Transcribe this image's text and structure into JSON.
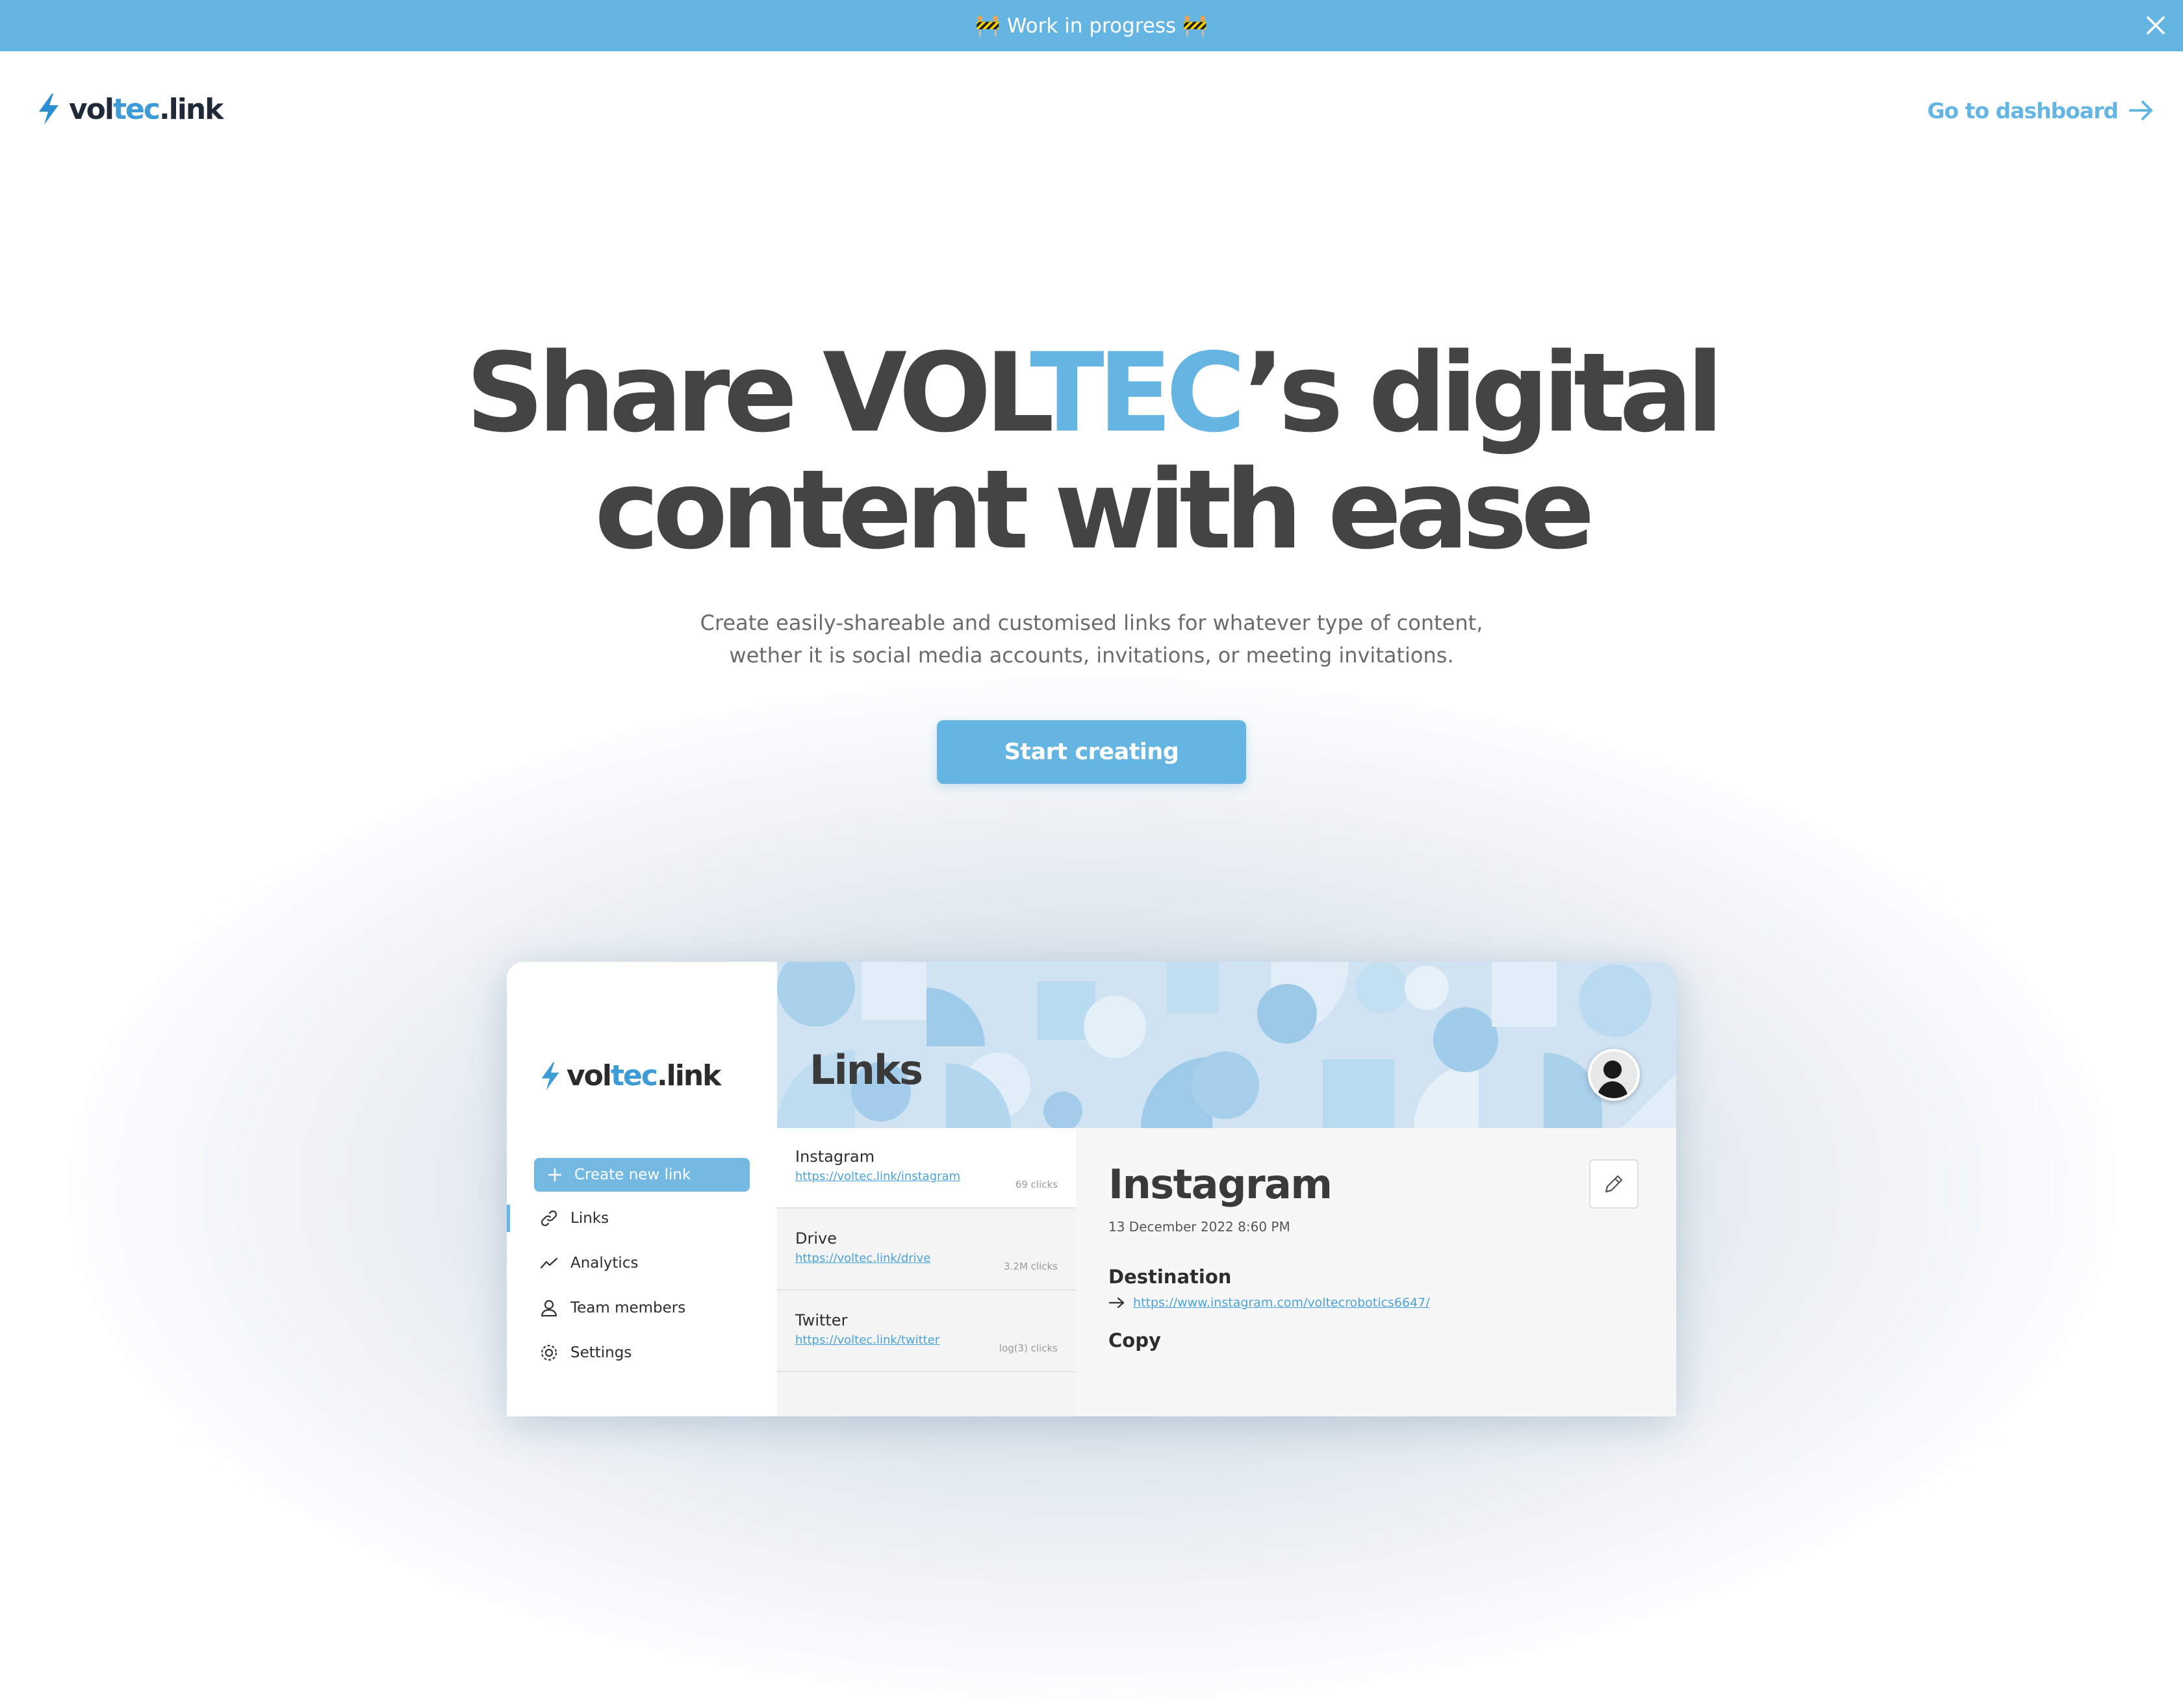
{
  "banner": {
    "text": "🚧 Work in progress 🚧"
  },
  "header": {
    "logo": {
      "part1": "vol",
      "part2": "tec",
      "part3": ".link"
    },
    "dashboard_link": "Go to dashboard"
  },
  "hero": {
    "title_1": "Share VOL",
    "title_accent": "TEC",
    "title_2": "’s digital",
    "title_line2": "content with ease",
    "subtitle_line1": "Create easily-shareable and customised links for whatever type of content,",
    "subtitle_line2": "wether it is social media accounts, invitations, or meeting invitations.",
    "cta": "Start creating"
  },
  "app_preview": {
    "logo": {
      "part1": "vol",
      "part2": "tec",
      "part3": ".link"
    },
    "create_button": "Create new link",
    "nav": [
      {
        "label": "Links",
        "icon": "link-icon"
      },
      {
        "label": "Analytics",
        "icon": "trend-icon"
      },
      {
        "label": "Team members",
        "icon": "user-icon"
      },
      {
        "label": "Settings",
        "icon": "gear-icon"
      }
    ],
    "page_title": "Links",
    "links": [
      {
        "name": "Instagram",
        "url": "https://voltec.link/instagram",
        "clicks": "69 clicks"
      },
      {
        "name": "Drive",
        "url": "https://voltec.link/drive",
        "clicks": "3.2M clicks"
      },
      {
        "name": "Twitter",
        "url": "https://voltec.link/twitter",
        "clicks": "log(3) clicks"
      }
    ],
    "detail": {
      "title": "Instagram",
      "date": "13 December 2022 8:60 PM",
      "destination_label": "Destination",
      "destination_url": "https://www.instagram.com/voltecrobotics6647/",
      "copy_label": "Copy"
    }
  },
  "colors": {
    "accent": "#65b5e3",
    "text": "#444444",
    "brand_blue": "#3d9bd6"
  }
}
